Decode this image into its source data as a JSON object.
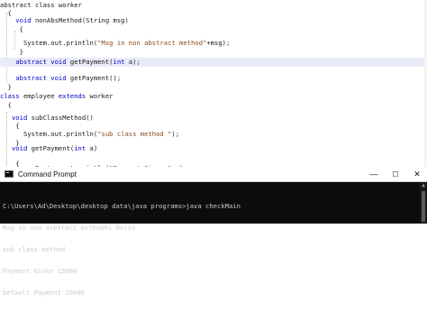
{
  "editor": {
    "lines": [
      [
        {
          "t": "abstract class ",
          "c": "plain"
        },
        {
          "t": "worker",
          "c": "plain"
        }
      ],
      [
        {
          "t": "  {",
          "c": "plain"
        }
      ],
      [
        {
          "t": "    void ",
          "c": "kw"
        },
        {
          "t": "nonAbsMethod(String msg)",
          "c": "plain"
        }
      ],
      [
        {
          "t": "     {",
          "c": "plain"
        }
      ],
      [
        {
          "t": "",
          "c": "plain"
        }
      ],
      [
        {
          "t": "      System.out.println(",
          "c": "plain"
        },
        {
          "t": "\"Msg in non abstract method\"",
          "c": "str"
        },
        {
          "t": "+msg);",
          "c": "plain"
        }
      ],
      [
        {
          "t": "     }",
          "c": "plain"
        }
      ],
      [
        {
          "t": "",
          "c": "plain"
        }
      ],
      [
        {
          "t": "    abstract void ",
          "c": "kw"
        },
        {
          "t": "getPayment(",
          "c": "plain"
        },
        {
          "t": "int",
          "c": "kw"
        },
        {
          "t": " a);",
          "c": "plain"
        }
      ],
      [
        {
          "t": "",
          "c": "plain"
        }
      ],
      [
        {
          "t": "    abstract void ",
          "c": "kw"
        },
        {
          "t": "getPayment();",
          "c": "plain"
        }
      ],
      [
        {
          "t": "  }",
          "c": "plain"
        }
      ],
      [
        {
          "t": "",
          "c": "plain"
        }
      ],
      [
        {
          "t": "class ",
          "c": "kw"
        },
        {
          "t": "employee ",
          "c": "plain"
        },
        {
          "t": "extends",
          "c": "kw"
        },
        {
          "t": " worker",
          "c": "plain"
        }
      ],
      [
        {
          "t": "  {",
          "c": "plain"
        }
      ],
      [
        {
          "t": "   void ",
          "c": "kw"
        },
        {
          "t": "subClassMethod()",
          "c": "plain"
        }
      ],
      [
        {
          "t": "    {",
          "c": "plain"
        }
      ],
      [
        {
          "t": "      System.out.println(",
          "c": "plain"
        },
        {
          "t": "\"sub class method \"",
          "c": "str"
        },
        {
          "t": ");",
          "c": "plain"
        }
      ],
      [
        {
          "t": "    }",
          "c": "plain"
        }
      ],
      [
        {
          "t": "   void ",
          "c": "kw"
        },
        {
          "t": "getPayment(",
          "c": "plain"
        },
        {
          "t": "int",
          "c": "kw"
        },
        {
          "t": " a)",
          "c": "plain"
        }
      ],
      [
        {
          "t": "",
          "c": "plain"
        }
      ],
      [
        {
          "t": "    {",
          "c": "plain"
        }
      ],
      [
        {
          "t": "         System.out.println(",
          "c": "plain"
        },
        {
          "t": "\"Payment Given \"",
          "c": "str"
        },
        {
          "t": "+a);",
          "c": "plain"
        }
      ]
    ]
  },
  "cmd": {
    "title": "Command Prompt",
    "minimize": "—",
    "maximize": "☐",
    "close": "✕",
    "lines": [
      "C:\\Users\\Ad\\Desktop\\desktop data\\java programs>java checkMain",
      "Msg in non asbtract methodHi Hello",
      "sub class method",
      "Payment Given 15000",
      "Default Payment 10000"
    ]
  },
  "icons": {
    "app": "command-prompt-icon",
    "scroll_up": "scroll-up-arrow-icon"
  }
}
